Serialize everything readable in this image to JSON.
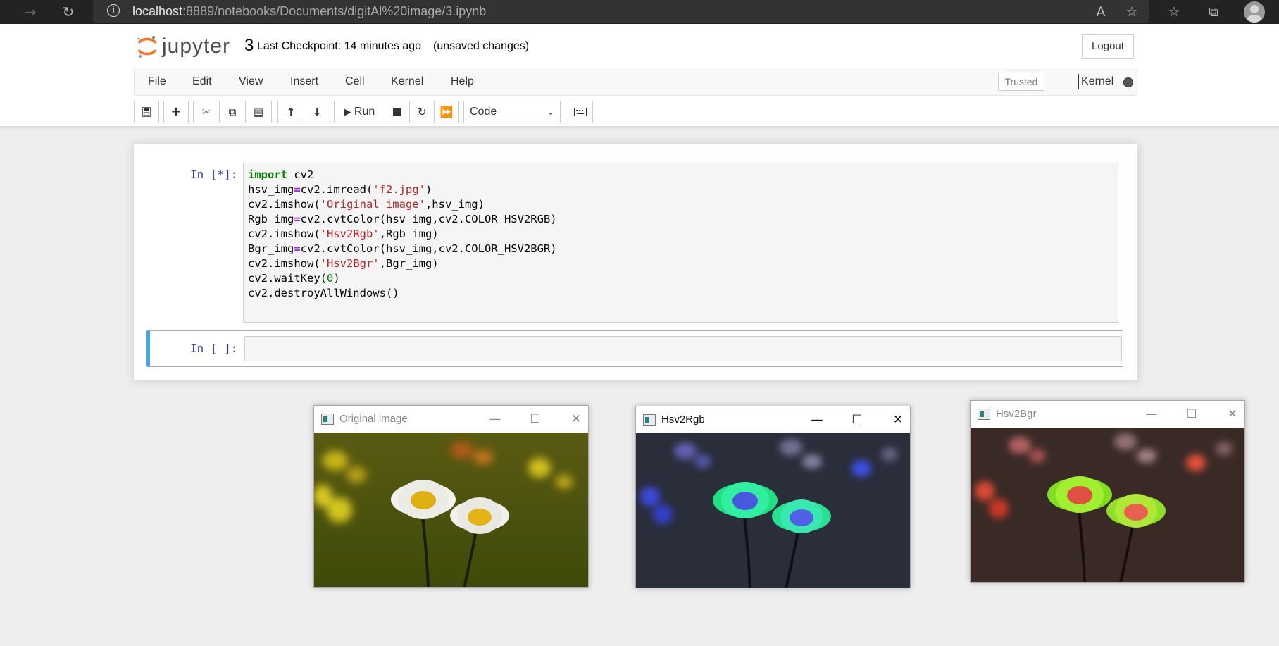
{
  "browser": {
    "url_host": "localhost",
    "url_rest": ":8889/notebooks/Documents/digitAl%20image/3.ipynb",
    "info_glyph": "i"
  },
  "header": {
    "logo_text": "jupyter",
    "notebook_name": "3",
    "checkpoint": "Last Checkpoint: 14 minutes ago",
    "unsaved": "(unsaved changes)",
    "logout_label": "Logout"
  },
  "menu": {
    "items": [
      "File",
      "Edit",
      "View",
      "Insert",
      "Cell",
      "Kernel",
      "Help"
    ],
    "trusted_label": "Trusted",
    "kernel_label": "Kernel"
  },
  "toolbar": {
    "run_label": "Run",
    "cell_type": "Code"
  },
  "cells": {
    "cell1_prompt": "In [*]:",
    "cell2_prompt": "In [ ]:",
    "code_lines": [
      "import cv2",
      "hsv_img=cv2.imread('f2.jpg')",
      "cv2.imshow('Original image',hsv_img)",
      "Rgb_img=cv2.cvtColor(hsv_img,cv2.COLOR_HSV2RGB)",
      "cv2.imshow('Hsv2Rgb',Rgb_img)",
      "Bgr_img=cv2.cvtColor(hsv_img,cv2.COLOR_HSV2BGR)",
      "cv2.imshow('Hsv2Bgr',Bgr_img)",
      "cv2.waitKey(0)",
      "cv2.destroyAllWindows()"
    ]
  },
  "windows": {
    "original_title": "Original image",
    "rgb_title": "Hsv2Rgb",
    "bgr_title": "Hsv2Bgr"
  },
  "colors": {
    "accent_blue": "#42a5f5",
    "prompt_blue": "#303f9f",
    "keyword_green": "#008000",
    "string_red": "#ba2121"
  }
}
